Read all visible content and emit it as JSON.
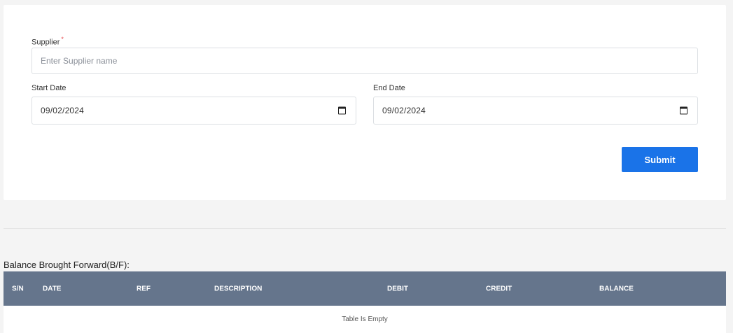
{
  "form": {
    "supplier_label": "Supplier",
    "required_mark": "*",
    "supplier_placeholder": "Enter Supplier name",
    "start_date_label": "Start Date",
    "start_date_value": "09/02/2024",
    "end_date_label": "End Date",
    "end_date_value": "09/02/2024",
    "submit_label": "Submit"
  },
  "ledger": {
    "title": "Balance Brought Forward(B/F):",
    "columns": [
      "S/N",
      "DATE",
      "REF",
      "DESCRIPTION",
      "DEBIT",
      "CREDIT",
      "BALANCE"
    ],
    "empty_text": "Table Is Empty"
  },
  "colors": {
    "accent": "#1a73e8",
    "table_header": "#65758c",
    "required": "#e5484d"
  }
}
